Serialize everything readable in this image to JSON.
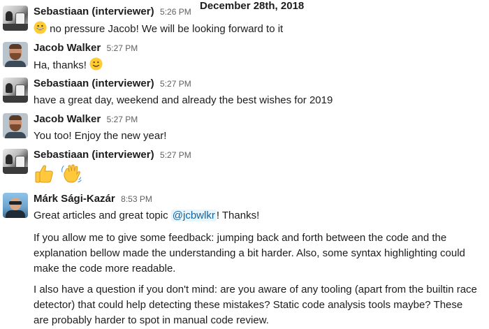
{
  "date_divider": "December 28th, 2018",
  "messages": [
    {
      "author": "Sebastiaan (interviewer)",
      "time": "5:26 PM",
      "text": "no pressure Jacob! We will be looking forward to it",
      "emoji": "grinning-face"
    },
    {
      "author": "Jacob Walker",
      "time": "5:27 PM",
      "text": "Ha, thanks!",
      "emoji": "slightly-smiling-face"
    },
    {
      "author": "Sebastiaan (interviewer)",
      "time": "5:27 PM",
      "text": "have a great day, weekend and already the best wishes for 2019"
    },
    {
      "author": "Jacob Walker",
      "time": "5:27 PM",
      "text": "You too! Enjoy the new year!"
    },
    {
      "author": "Sebastiaan (interviewer)",
      "time": "5:27 PM",
      "emojis": [
        "thumbs-up",
        "waving-hand"
      ]
    },
    {
      "author": "Márk Sági-Kazár",
      "time": "8:53 PM",
      "text_before_mention": "Great articles and great topic ",
      "mention": "@jcbwlkr",
      "text_after_mention": "! Thanks!",
      "para2": "If you allow me to give some feedback: jumping back and forth between the code and the explanation bellow made the understanding a bit harder. Also, some syntax highlighting could make the code more readable.",
      "para3": "I also have a question if you don't mind: are you aware of any tooling (apart from the builtin race detector) that could help detecting these mistakes? Static code analysis tools maybe? These are probably harder to spot in manual code review."
    }
  ],
  "colors": {
    "mention_text": "#1264a3",
    "mention_bg": "#e8f5fa",
    "timestamp": "#616061",
    "text": "#1d1c1d"
  }
}
